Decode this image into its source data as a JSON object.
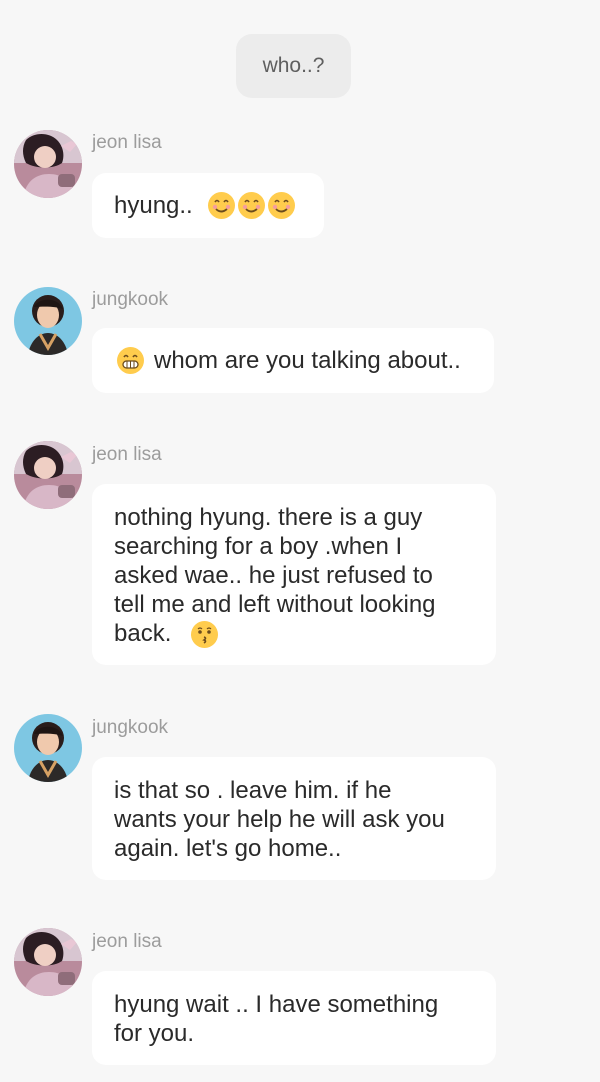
{
  "system_bubble": {
    "text": "who..?"
  },
  "messages": [
    {
      "sender": "jeon lisa",
      "avatar": "lisa-avatar",
      "text": "hyung..",
      "emojis": [
        "smiling-blush-emoji",
        "smiling-blush-emoji",
        "smiling-blush-emoji"
      ]
    },
    {
      "sender": "jungkook",
      "avatar": "jungkook-avatar",
      "text": "whom are you talking about..",
      "lead_emoji": "grinning-teeth-emoji"
    },
    {
      "sender": "jeon lisa",
      "avatar": "lisa-avatar",
      "line1": "nothing hyung.  there is a guy",
      "line2": "searching for a boy .when I",
      "line3": "asked wae.. he just refused to",
      "line4": "tell me and left without looking",
      "line5": "back.",
      "trail_emoji": "kissing-emoji"
    },
    {
      "sender": "jungkook",
      "avatar": "jungkook-avatar",
      "line1": "is that so . leave him. if he",
      "line2": "wants your help he will ask you",
      "line3": "again.  let's go home.."
    },
    {
      "sender": "jeon lisa",
      "avatar": "lisa-avatar",
      "line1": "hyung wait .. I have something",
      "line2": "for you."
    }
  ]
}
